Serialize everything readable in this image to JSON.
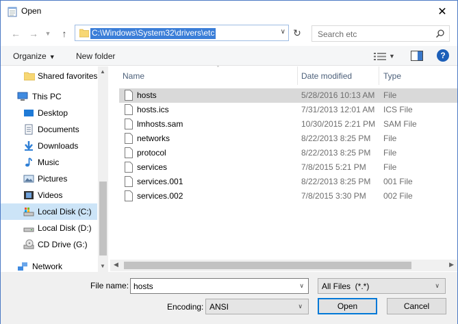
{
  "window": {
    "title": "Open",
    "close_glyph": "✕"
  },
  "address": {
    "path": "C:\\Windows\\System32\\drivers\\etc",
    "folder_color": "#f7d774"
  },
  "search": {
    "placeholder": "Search etc"
  },
  "toolbar": {
    "organize_label": "Organize",
    "new_folder_label": "New folder",
    "help_label": "?"
  },
  "nav": {
    "items": [
      {
        "label": "Shared favorites",
        "icon": "folder-icon"
      },
      {
        "label": "This PC",
        "icon": "computer-icon"
      },
      {
        "label": "Desktop",
        "icon": "desktop-icon"
      },
      {
        "label": "Documents",
        "icon": "documents-icon"
      },
      {
        "label": "Downloads",
        "icon": "downloads-icon"
      },
      {
        "label": "Music",
        "icon": "music-icon"
      },
      {
        "label": "Pictures",
        "icon": "pictures-icon"
      },
      {
        "label": "Videos",
        "icon": "videos-icon"
      },
      {
        "label": "Local Disk (C:)",
        "icon": "drive-icon",
        "selected": true
      },
      {
        "label": "Local Disk (D:)",
        "icon": "drive-icon"
      },
      {
        "label": "CD Drive (G:)",
        "icon": "cd-drive-icon"
      },
      {
        "label": "Network",
        "icon": "network-icon"
      }
    ]
  },
  "columns": {
    "name": "Name",
    "date": "Date modified",
    "type": "Type"
  },
  "files": [
    {
      "name": "hosts",
      "date": "5/28/2016 10:13 AM",
      "type": "File",
      "selected": true
    },
    {
      "name": "hosts.ics",
      "date": "7/31/2013 12:01 AM",
      "type": "ICS File"
    },
    {
      "name": "lmhosts.sam",
      "date": "10/30/2015 2:21 PM",
      "type": "SAM File"
    },
    {
      "name": "networks",
      "date": "8/22/2013 8:25 PM",
      "type": "File"
    },
    {
      "name": "protocol",
      "date": "8/22/2013 8:25 PM",
      "type": "File"
    },
    {
      "name": "services",
      "date": "7/8/2015 5:21 PM",
      "type": "File"
    },
    {
      "name": "services.001",
      "date": "8/22/2013 8:25 PM",
      "type": "001 File"
    },
    {
      "name": "services.002",
      "date": "7/8/2015 3:30 PM",
      "type": "002 File"
    }
  ],
  "bottom": {
    "file_name_label": "File name:",
    "file_name_value": "hosts",
    "filter_value": "All Files  (*.*)",
    "encoding_label": "Encoding:",
    "encoding_value": "ANSI",
    "open_label": "Open",
    "cancel_label": "Cancel"
  },
  "colors": {
    "accent": "#0078d7",
    "selection": "#cce4f7",
    "address_highlight": "#3b7ed8"
  }
}
